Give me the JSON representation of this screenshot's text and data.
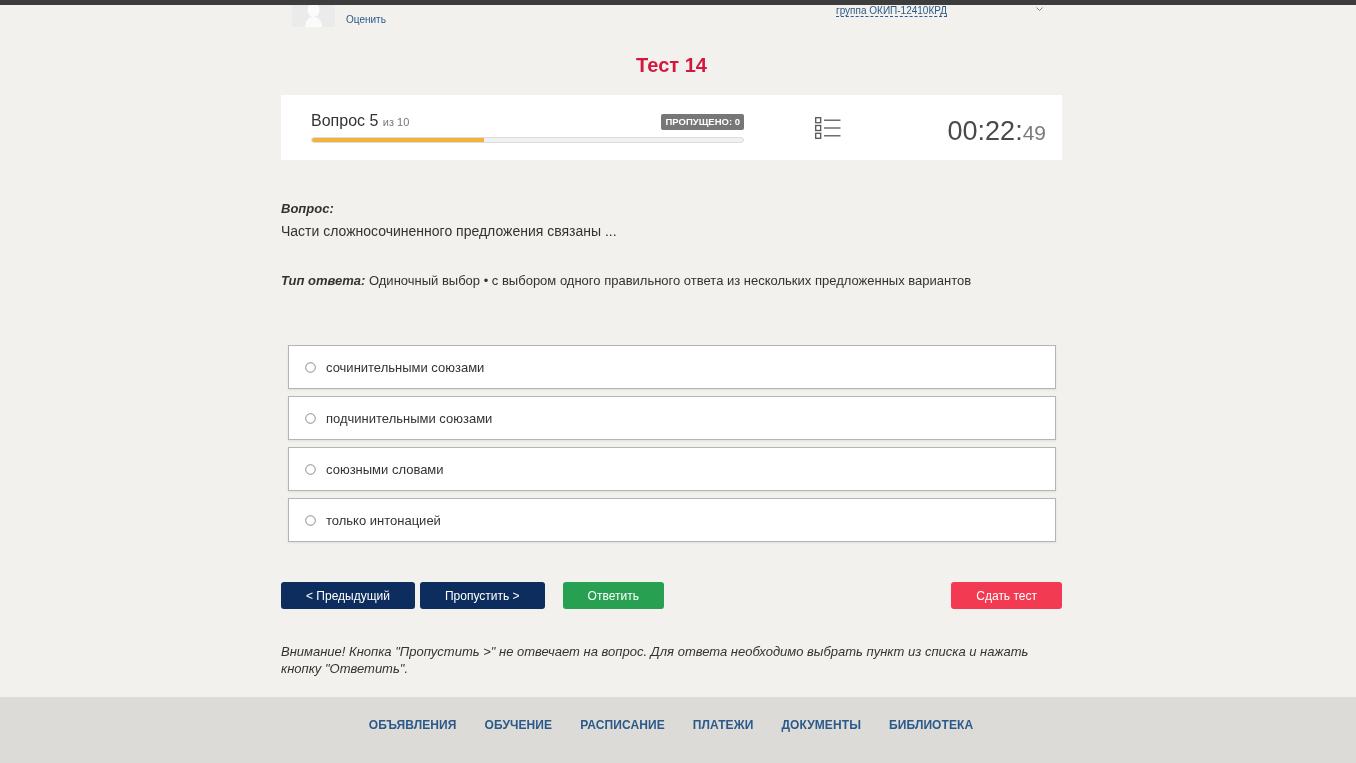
{
  "header": {
    "rate_link": "Оценить",
    "group": "группа ОКИП-12410КРД"
  },
  "title": "Тест 14",
  "progress": {
    "question_label": "Вопрос 5",
    "of_label": "из 10",
    "skipped_badge": "ПРОПУЩЕНО: 0",
    "level": 0.4,
    "timer_main": "00:22:",
    "timer_seconds": "49"
  },
  "question": {
    "label": "Вопрос:",
    "text": "Части сложносочиненного предложения связаны ...",
    "answer_type_label": "Тип ответа:",
    "answer_type": "Одиночный выбор • с выбором одного правильного ответа из нескольких предложенных вариантов"
  },
  "options": [
    {
      "label": "сочинительными союзами",
      "selected": false
    },
    {
      "label": "подчинительными союзами",
      "selected": false
    },
    {
      "label": "союзными словами",
      "selected": false
    },
    {
      "label": "только интонацией",
      "selected": false
    }
  ],
  "buttons": [
    {
      "label": "< Предыдущий",
      "kind": "primary"
    },
    {
      "label": "Пропустить >",
      "kind": "primary"
    },
    {
      "label": "Ответить",
      "kind": "success"
    },
    {
      "label": "Сдать тест",
      "kind": "danger"
    }
  ],
  "notice": "Внимание! Кнопка \"Пропустить >\" не отвечает на вопрос. Для ответа необходимо выбрать пункт из списка и нажать кнопку \"Ответить\".",
  "footer_nav": [
    "ОБЪЯВЛЕНИЯ",
    "ОБУЧЕНИЕ",
    "РАСПИСАНИЕ",
    "ПЛАТЕЖИ",
    "ДОКУМЕНТЫ",
    "БИБЛИОТЕКА"
  ]
}
